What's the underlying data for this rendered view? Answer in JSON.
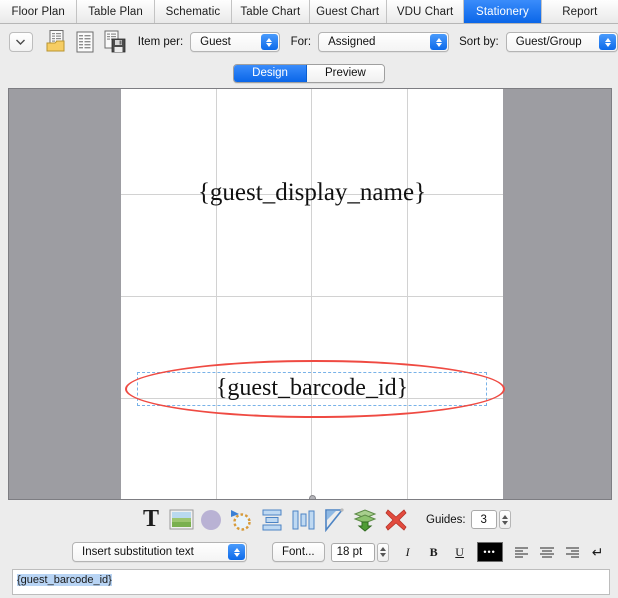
{
  "tabs": [
    {
      "label": "Floor Plan",
      "selected": false
    },
    {
      "label": "Table Plan",
      "selected": false
    },
    {
      "label": "Schematic",
      "selected": false
    },
    {
      "label": "Table Chart",
      "selected": false
    },
    {
      "label": "Guest Chart",
      "selected": false
    },
    {
      "label": "VDU Chart",
      "selected": false
    },
    {
      "label": "Stationery",
      "selected": true
    },
    {
      "label": "Report",
      "selected": false
    }
  ],
  "toolbar": {
    "menu_chevron_icon": "chevron-down-icon",
    "open_icon": "open-document-icon",
    "new_icon": "new-document-icon",
    "save_icon": "save-document-icon",
    "item_per_label": "Item per:",
    "item_per_value": "Guest",
    "for_label": "For:",
    "for_value": "Assigned",
    "sort_by_label": "Sort by:",
    "sort_by_value": "Guest/Group"
  },
  "view_modes": {
    "design_label": "Design",
    "preview_label": "Preview",
    "selected": "Design"
  },
  "canvas": {
    "display_name_field": "{guest_display_name}",
    "barcode_field": "{guest_barcode_id}",
    "selection_highlight_color": "#ef4a42",
    "selection_box_color": "#78b2e8",
    "page_background": "#ffffff",
    "pasteboard_color": "#9d9da2",
    "guide_color": "#d2d2d2"
  },
  "icon_toolbar": {
    "items": [
      {
        "name": "text-tool-icon",
        "title": "T"
      },
      {
        "name": "image-tool-icon",
        "title": ""
      },
      {
        "name": "shape-circle-tool-icon",
        "title": ""
      },
      {
        "name": "rotate-tool-icon",
        "title": ""
      },
      {
        "name": "align-distribute-vertical-icon",
        "title": ""
      },
      {
        "name": "align-distribute-horizontal-icon",
        "title": ""
      },
      {
        "name": "flip-tool-icon",
        "title": ""
      },
      {
        "name": "send-to-back-icon",
        "title": ""
      },
      {
        "name": "delete-tool-icon",
        "title": ""
      }
    ],
    "guides_label": "Guides:",
    "guides_value": "3"
  },
  "format_bar": {
    "substitution_value": "Insert substitution text",
    "font_button_label": "Font...",
    "font_size_value": "18 pt",
    "italic_label": "I",
    "bold_label": "B",
    "underline_label": "U",
    "color_well_label": "•••",
    "color_well_value": "#000000",
    "align_left_icon": "align-left-icon",
    "align_center_icon": "align-center-icon",
    "align_right_icon": "align-right-icon",
    "wrap_icon": "line-return-icon"
  },
  "source_field": {
    "value": "{guest_barcode_id}",
    "selection_color": "#b8d4f4"
  }
}
